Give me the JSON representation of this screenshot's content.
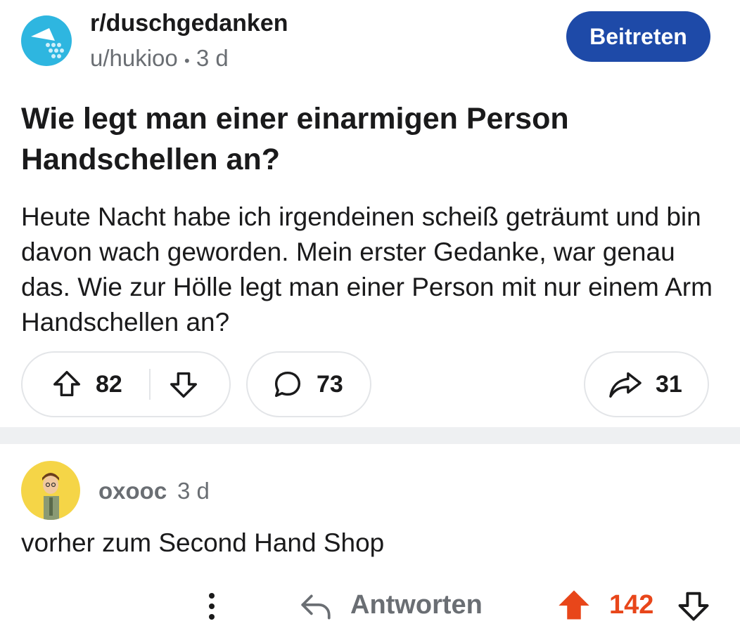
{
  "post": {
    "subreddit": "r/duschgedanken",
    "author": "u/hukioo",
    "separator": "•",
    "age": "3 d",
    "join_label": "Beitreten",
    "title": "Wie legt man einer einarmigen Person Handschellen an?",
    "body": "Heute Nacht habe ich irgendeinen scheiß geträumt und bin davon wach geworden. Mein erster Gedanke, war genau das. Wie zur Hölle legt man einer Person mit nur einem Arm Handschellen an?",
    "upvotes": "82",
    "comments": "73",
    "shares": "31"
  },
  "comment": {
    "user": "oxooc",
    "age": "3 d",
    "text": "vorher zum Second Hand Shop",
    "reply_label": "Antworten",
    "score": "142"
  },
  "colors": {
    "join_button": "#1e4aa8",
    "subreddit_avatar": "#2eb6e0",
    "comment_avatar": "#f5d547",
    "upvote_active": "#e8461a",
    "muted_text": "#6a6e73"
  },
  "icons": [
    "shower-icon",
    "upvote-icon",
    "downvote-icon",
    "comment-icon",
    "share-icon",
    "more-icon",
    "reply-icon",
    "upvote-filled-icon"
  ]
}
